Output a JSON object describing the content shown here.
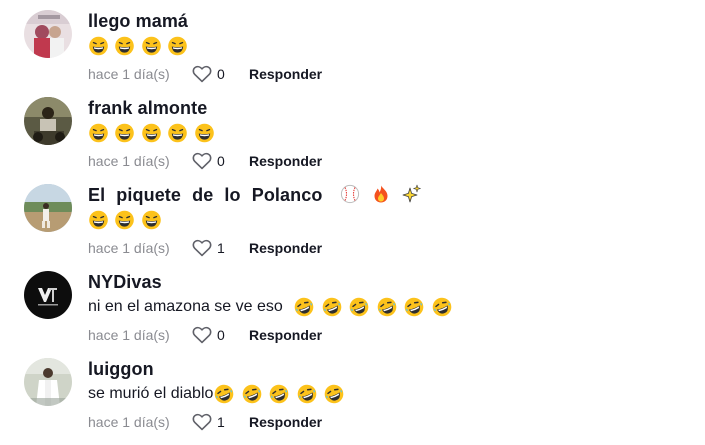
{
  "comments": [
    {
      "username": "llego mamá",
      "text": "",
      "emojis": [
        "grin-sweat",
        "grin-sweat",
        "grin-sweat",
        "grin-sweat"
      ],
      "time": "hace 1 día(s)",
      "likes": "0",
      "reply_label": "Responder"
    },
    {
      "username": "frank almonte",
      "text": "",
      "emojis": [
        "grin-sweat",
        "grin-sweat",
        "grin-sweat",
        "grin-sweat",
        "grin-sweat"
      ],
      "time": "hace 1 día(s)",
      "likes": "0",
      "reply_label": "Responder"
    },
    {
      "username": "El piquete de lo Polanco",
      "username_emojis": [
        "baseball",
        "fire",
        "sparkles"
      ],
      "text": "",
      "emojis": [
        "grin-sweat",
        "grin-sweat",
        "grin-sweat"
      ],
      "time": "hace 1 día(s)",
      "likes": "1",
      "reply_label": "Responder"
    },
    {
      "username": "NYDivas",
      "text": "ni en el amazona se ve eso",
      "emojis": [
        "rofl",
        "rofl",
        "rofl",
        "rofl",
        "rofl",
        "rofl"
      ],
      "time": "hace 1 día(s)",
      "likes": "0",
      "reply_label": "Responder"
    },
    {
      "username": "luiggon",
      "text": "se murió el diablo",
      "emojis": [
        "rofl",
        "rofl",
        "rofl",
        "rofl",
        "rofl"
      ],
      "time": "hace 1 día(s)",
      "likes": "1",
      "reply_label": "Responder"
    }
  ],
  "colors": {
    "text": "#161823",
    "muted": "#8a8b91",
    "emoji_yellow": "#fcc21b"
  }
}
